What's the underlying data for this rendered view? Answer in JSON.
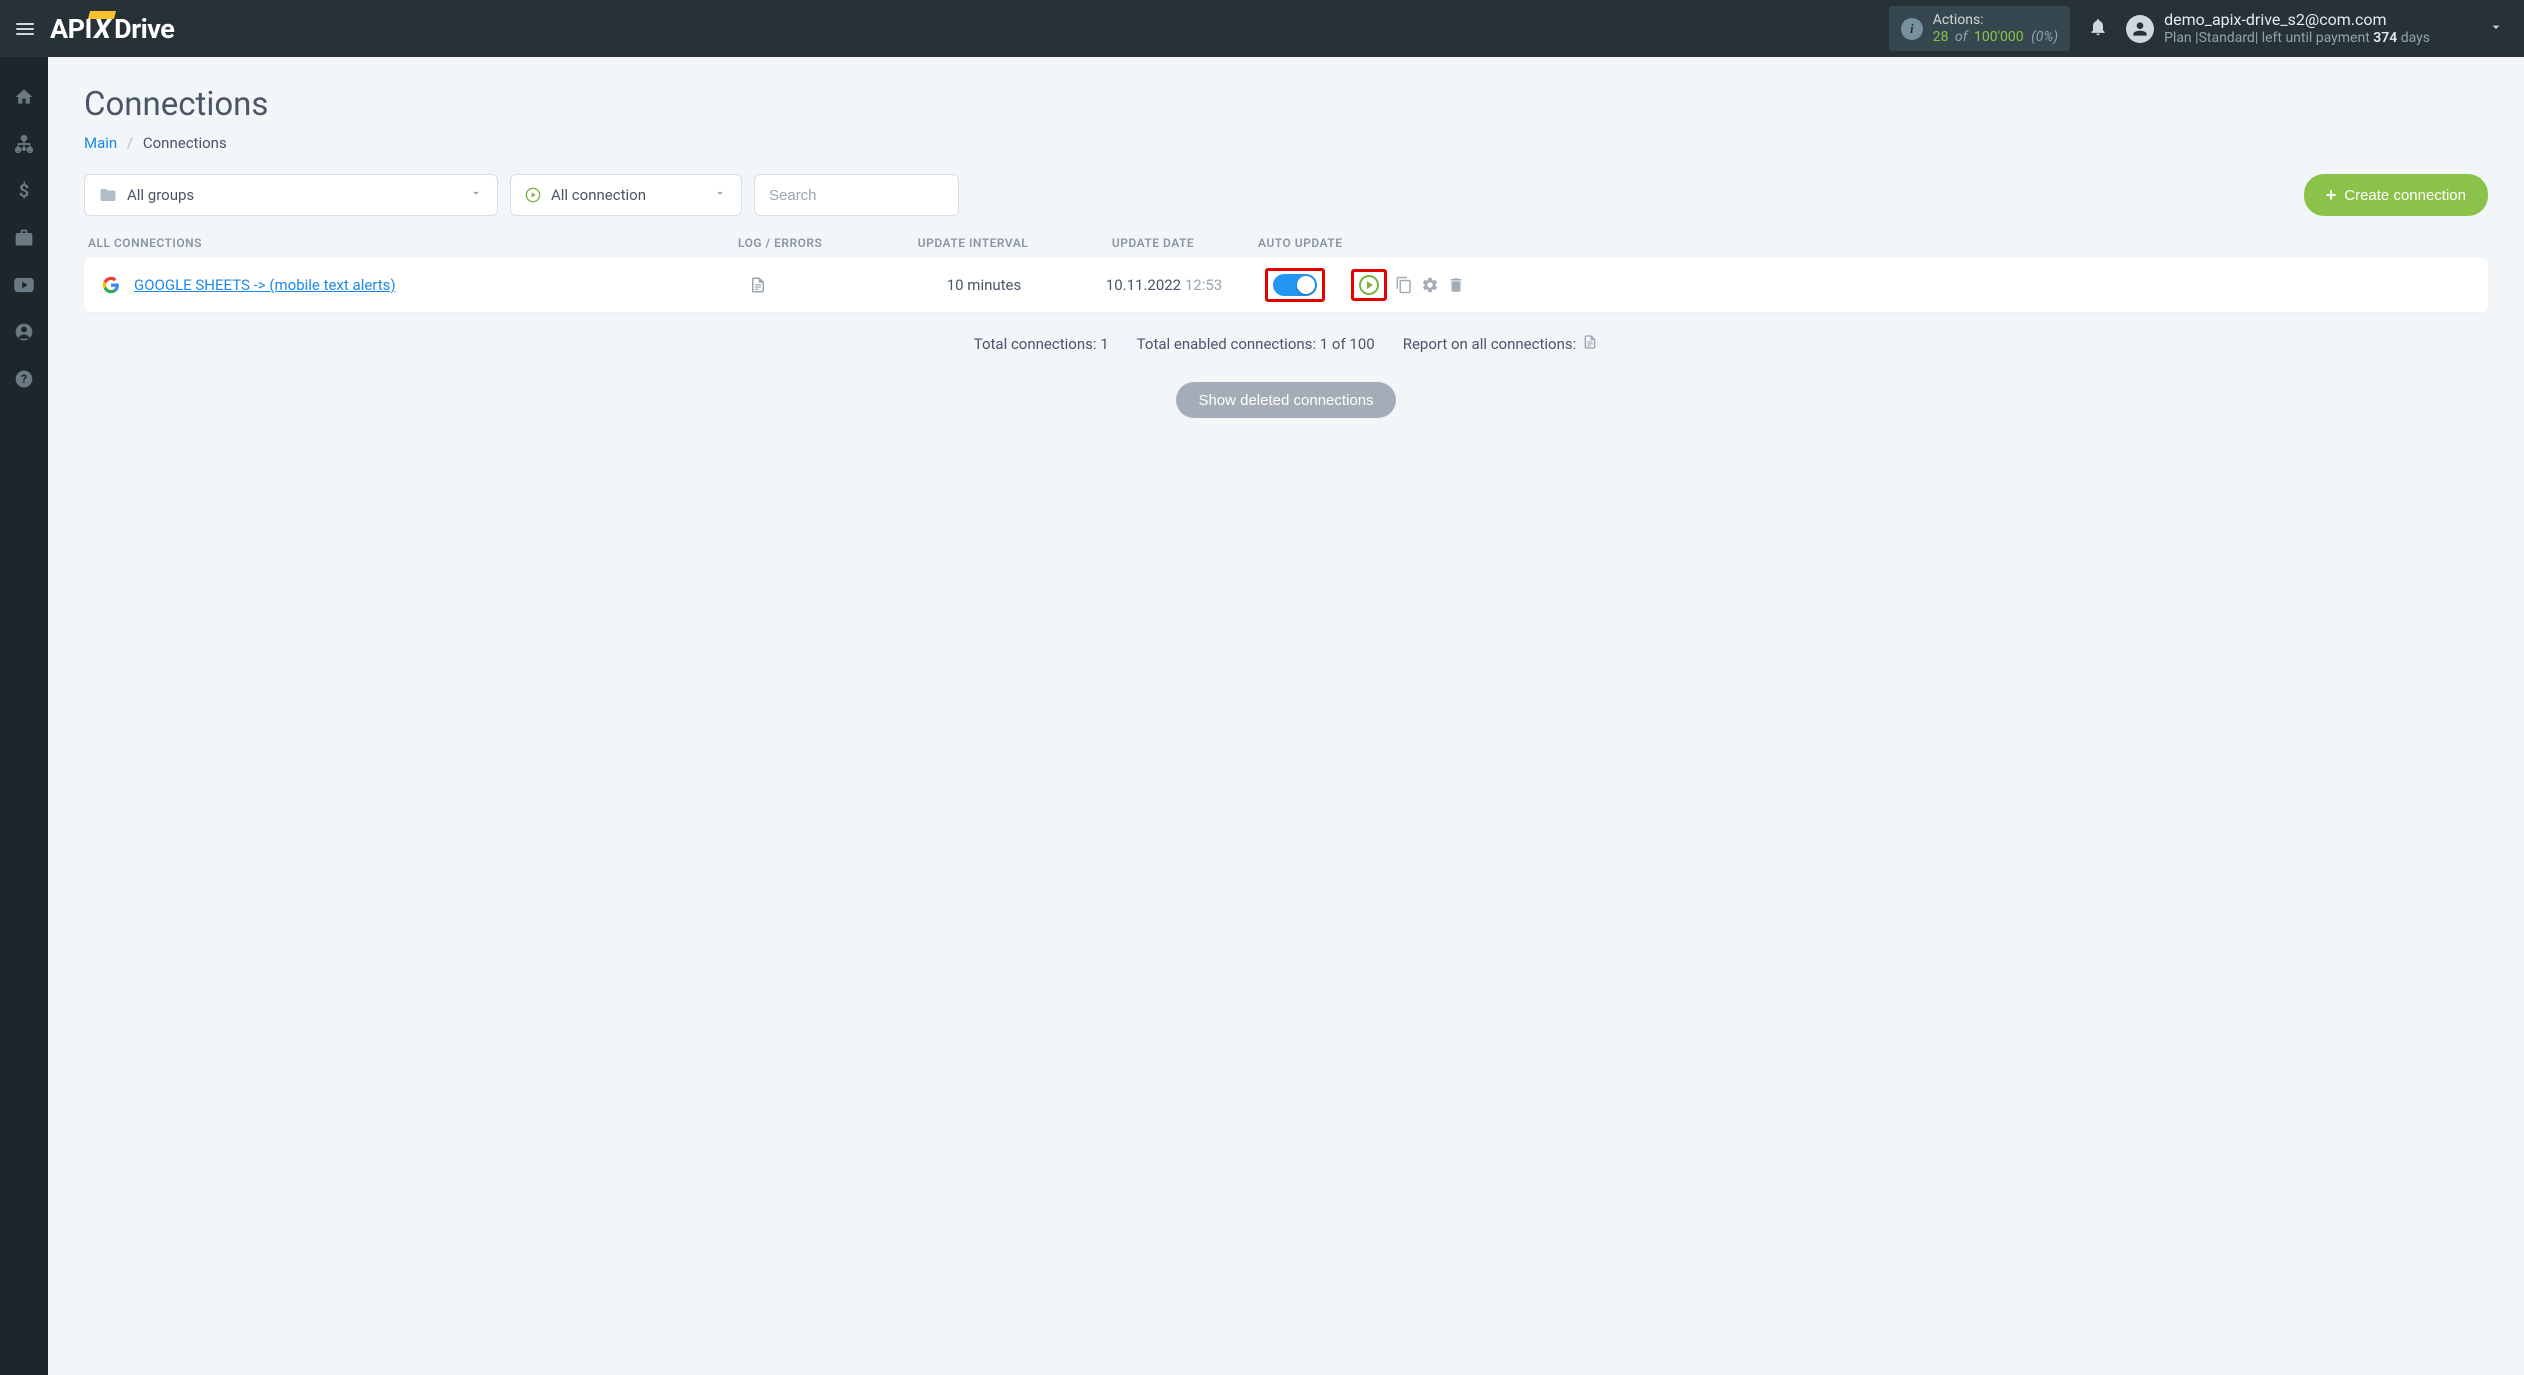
{
  "header": {
    "logo_parts": {
      "api": "API",
      "x": "X",
      "drive": "Drive"
    },
    "actions": {
      "label": "Actions:",
      "count": "28",
      "of": "of",
      "total": "100'000",
      "pct": "(0%)"
    },
    "user": {
      "email": "demo_apix-drive_s2@com.com",
      "plan_prefix": "Plan |",
      "plan_name": "Standard",
      "plan_mid": "| left until payment ",
      "days": "374",
      "days_suffix": " days"
    }
  },
  "sidebar": {
    "items": [
      "home",
      "sitemap",
      "dollar",
      "briefcase",
      "youtube",
      "user",
      "help"
    ]
  },
  "page": {
    "title": "Connections",
    "breadcrumb_main": "Main",
    "breadcrumb_current": "Connections"
  },
  "filters": {
    "groups": "All groups",
    "connections": "All connection",
    "search_placeholder": "Search",
    "create_button": "Create connection"
  },
  "table": {
    "headers": {
      "all": "ALL CONNECTIONS",
      "log": "LOG / ERRORS",
      "interval": "UPDATE INTERVAL",
      "date": "UPDATE DATE",
      "auto": "AUTO UPDATE"
    },
    "row": {
      "name": "GOOGLE SHEETS -> (mobile text alerts)",
      "interval": "10 minutes",
      "date": "10.11.2022",
      "time": "12:53",
      "auto_on": true
    }
  },
  "summary": {
    "total_connections_label": "Total connections:",
    "total_connections_value": "1",
    "total_enabled_label": "Total enabled connections:",
    "total_enabled_value": "1 of 100",
    "report_label": "Report on all connections:"
  },
  "show_deleted": "Show deleted connections"
}
